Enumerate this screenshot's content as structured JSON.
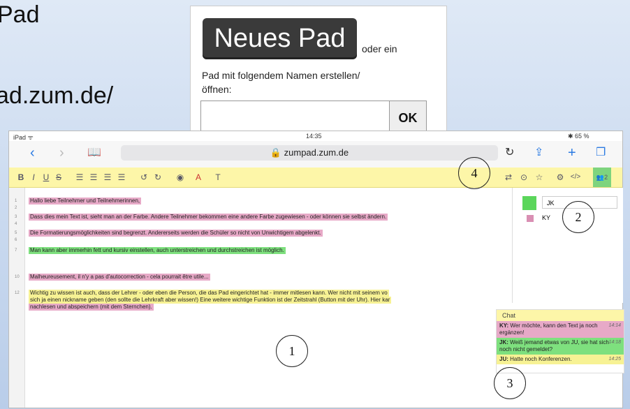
{
  "slide": {
    "title_fragment": "Pad",
    "url_fragment": "ad.zum.de/"
  },
  "newpad": {
    "button_label": "Neues Pad",
    "or_text": "oder ein",
    "label": "Pad mit folgendem Namen erstellen/öffnen:",
    "input_value": "",
    "ok_label": "OK"
  },
  "ipad": {
    "status_left": "iPad ᯤ",
    "status_time": "14:35",
    "status_battery": "✱ 65 %",
    "url": "🔒 zumpad.zum.de",
    "toolbar": [
      "B",
      "I",
      "U",
      "S",
      "☰",
      "☰",
      "☰",
      "☰",
      "↺",
      "↻",
      "◉",
      "A",
      "T"
    ],
    "toolbar_right": [
      "⇄",
      "⊙",
      "☆",
      "⚙",
      "</>",
      "👥2"
    ],
    "lines": [
      {
        "n": "1",
        "text": "Hallo liebe Teilnehmer und Teilnehmerinnen,",
        "color": "pink"
      },
      {
        "n": "2",
        "text": "",
        "color": ""
      },
      {
        "n": "3",
        "text": "Dass dies mein Text ist, sieht man an der Farbe. Andere Teilnehmer bekommen eine andere Farbe zugewiesen - oder können sie selbst ändern.",
        "color": "pink"
      },
      {
        "n": "4",
        "text": "",
        "color": ""
      },
      {
        "n": "5",
        "text": "Die Formatierungsmöglichkeiten sind begrenzt. Andererseits werden die Schüler so nicht von Unwichtigem abgelenkt.",
        "color": "pink"
      },
      {
        "n": "6",
        "text": "",
        "color": ""
      },
      {
        "n": "7",
        "text": "Man kann aber immerhin fett und kursiv einstellen, auch unterstreichen und durchstreichen ist möglich.",
        "color": "green"
      },
      {
        "n": "10",
        "text": "Malheureusement, il n'y a pas d'autocorrection - cela pourrait être utile...",
        "color": "pink"
      },
      {
        "n": "12",
        "text": "Wichtig zu wissen ist auch, dass der Lehrer - oder eben die Person, die das Pad eingerichtet hat - immer mitlesen kann. Wer nicht mit seinem vo",
        "color": "yellow"
      },
      {
        "n": "",
        "text": "sich ja einen nickname geben (den sollte die Lehrkraft aber wissen!) Eine weitere wichtige Funktion ist der Zeitstrahl (Button mit der Uhr). Hier kar",
        "color": "yellow"
      },
      {
        "n": "",
        "text": "nachlesen und abspeichern (mit dem Sternchen).",
        "color": "pink"
      }
    ],
    "users": [
      {
        "name": "JK",
        "color": "#5bd65b"
      },
      {
        "name": "KY",
        "color": "#d98fb3"
      }
    ],
    "chat": {
      "title": "Chat",
      "messages": [
        {
          "author": "KY:",
          "text": "Wer möchte, kann den Text ja noch ergänzen!",
          "time": "14:14",
          "color": "#e7a9c7"
        },
        {
          "author": "JK:",
          "text": "Weiß jemand etwas von JU, sie hat sich noch nicht gemeldet?",
          "time": "14:18",
          "color": "#7ee07e"
        },
        {
          "author": "JU:",
          "text": "Hatte noch Konferenzen.",
          "time": "14:25",
          "color": "#f7f294"
        }
      ]
    }
  },
  "callouts": [
    "1",
    "2",
    "3",
    "4"
  ],
  "colors": {
    "pad_yellow": "#fdf6a8",
    "user_pink": "#e7a9c7",
    "user_green": "#7ee07e",
    "link_blue": "#2a7ae2"
  }
}
